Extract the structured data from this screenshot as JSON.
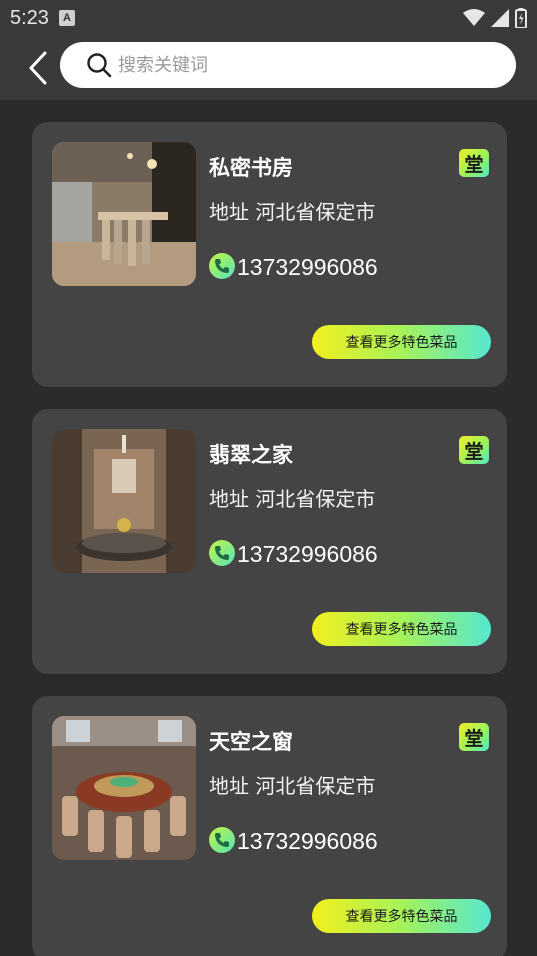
{
  "status_bar": {
    "time": "5:23",
    "notification_letter": "A"
  },
  "header": {
    "search": {
      "placeholder": "搜索关键词",
      "value": ""
    }
  },
  "colors": {
    "background": "#2b2b2b",
    "header": "#3a3a3a",
    "card": "#444444",
    "accent_yellow": "#f2f01e",
    "accent_green": "#a6f25a",
    "accent_cyan": "#55e7cf"
  },
  "restaurants": [
    {
      "name": "私密书房",
      "tag": "堂",
      "address": "地址 河北省保定市",
      "phone": "13732996086",
      "button": "查看更多特色菜品",
      "image_icon": "dining-room-photo"
    },
    {
      "name": "翡翠之家",
      "tag": "堂",
      "address": "地址 河北省保定市",
      "phone": "13732996086",
      "button": "查看更多特色菜品",
      "image_icon": "dining-room-photo"
    },
    {
      "name": "天空之窗",
      "tag": "堂",
      "address": "地址 河北省保定市",
      "phone": "13732996086",
      "button": "查看更多特色菜品",
      "image_icon": "banquet-hall-photo"
    }
  ]
}
